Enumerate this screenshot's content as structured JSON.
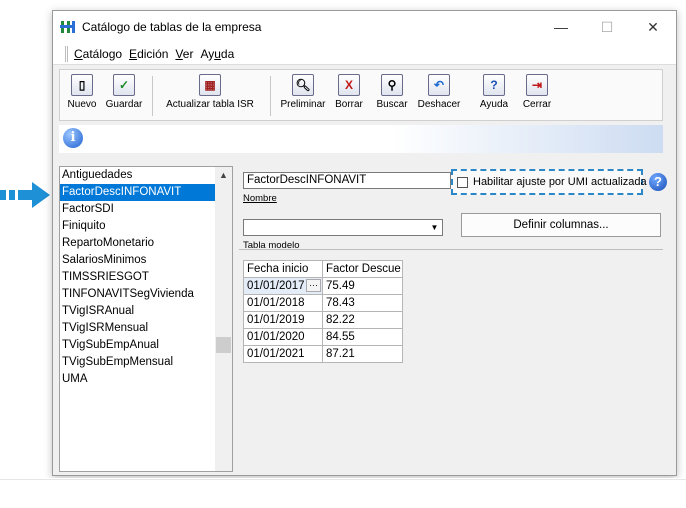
{
  "window": {
    "title": "Catálogo de tablas de la empresa",
    "controls": {
      "minimize": "—",
      "maximize": "☐",
      "close": "✕"
    }
  },
  "menu": [
    {
      "label": "Catálogo",
      "accel": "C",
      "rest": "atálogo"
    },
    {
      "label": "Edición",
      "accel": "E",
      "rest": "dición"
    },
    {
      "label": "Ver",
      "accel": "V",
      "rest": "er"
    },
    {
      "label": "Ayuda",
      "pre": "Ay",
      "accel": "u",
      "rest": "da"
    }
  ],
  "toolbar": {
    "nuevo": {
      "label": "Nuevo",
      "icon": "new-document-icon",
      "glyph": "▯"
    },
    "guardar": {
      "label": "Guardar",
      "icon": "save-check-icon",
      "glyph": "✓"
    },
    "actualizar": {
      "label": "Actualizar tabla ISR",
      "icon": "update-table-icon",
      "glyph": "▦"
    },
    "preliminar": {
      "label": "Preliminar",
      "icon": "preview-icon",
      "glyph": "🔍︎"
    },
    "borrar": {
      "label": "Borrar",
      "icon": "delete-icon",
      "glyph": "X"
    },
    "buscar": {
      "label": "Buscar",
      "icon": "binoculars-icon",
      "glyph": "⚲"
    },
    "deshacer": {
      "label": "Deshacer",
      "icon": "undo-icon",
      "glyph": "↶"
    },
    "ayuda": {
      "label": "Ayuda",
      "icon": "help-icon",
      "glyph": "?"
    },
    "cerrar": {
      "label": "Cerrar",
      "icon": "exit-icon",
      "glyph": "⇥"
    }
  },
  "info": {
    "glyph": "i"
  },
  "tables_list": [
    "Antiguedades",
    "FactorDescINFONAVIT",
    "FactorSDI",
    "Finiquito",
    "RepartoMonetario",
    "SalariosMinimos",
    "TIMSSRIESGOT",
    "TINFONAVITSegVivienda",
    "TVigISRAnual",
    "TVigISRMensual",
    "TVigSubEmpAnual",
    "TVigSubEmpMensual",
    "UMA"
  ],
  "selected_index": 1,
  "form": {
    "nombre_value": "FactorDescINFONAVIT",
    "nombre_label": "Nombre",
    "tabla_modelo_value": "",
    "tabla_modelo_label": "Tabla modelo",
    "checkbox_label": "Habilitar ajuste por UMI actualizada",
    "checkbox_checked": false,
    "definir_label": "Definir columnas...",
    "help_glyph": "?"
  },
  "grid": {
    "headers": [
      "Fecha  inicio",
      "Factor  Descue"
    ],
    "rows": [
      [
        "01/01/2017",
        "75.49"
      ],
      [
        "01/01/2018",
        "78.43"
      ],
      [
        "01/01/2019",
        "82.22"
      ],
      [
        "01/01/2020",
        "84.55"
      ],
      [
        "01/01/2021",
        "87.21"
      ]
    ],
    "ellipsis": "···"
  },
  "colors": {
    "accent": "#0078d7",
    "highlight_border": "#2b87c8",
    "arrow": "#1e90d6"
  }
}
